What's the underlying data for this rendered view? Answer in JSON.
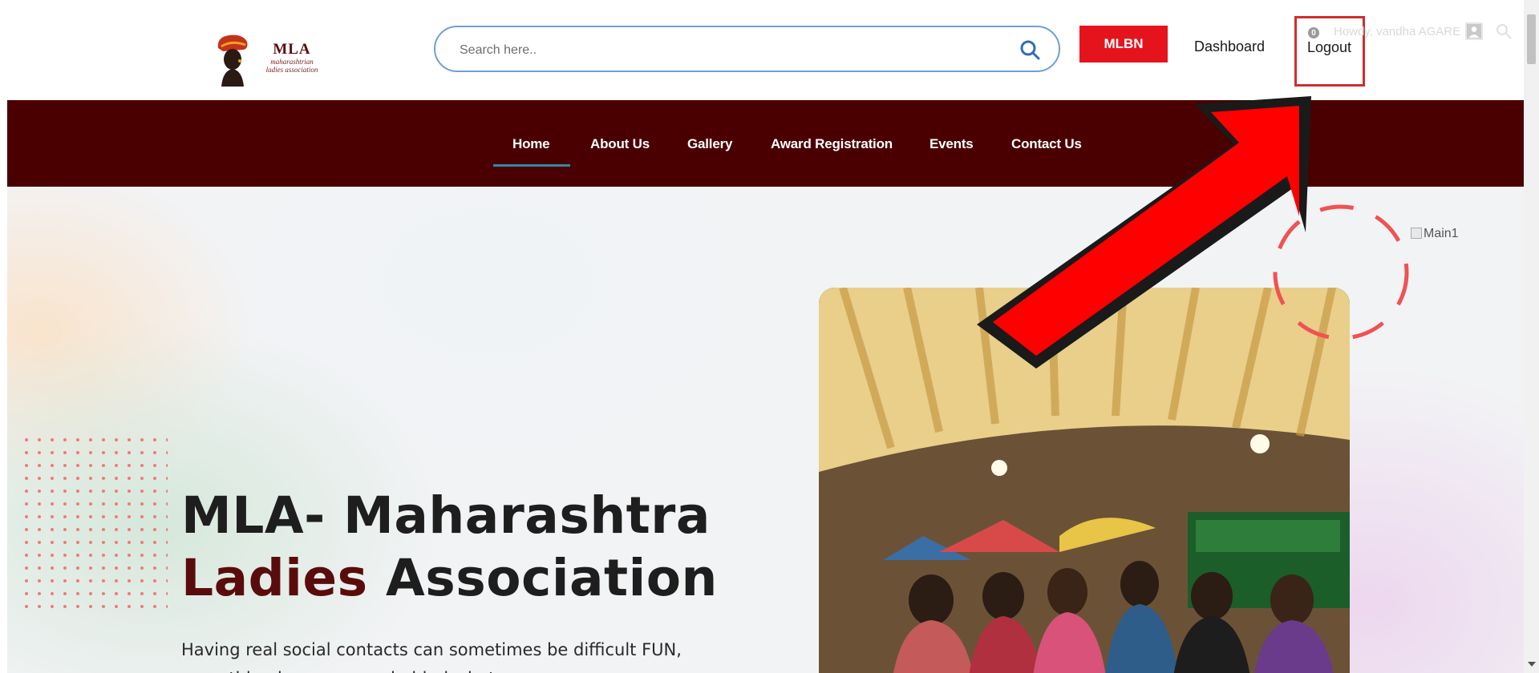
{
  "header": {
    "logo": {
      "text_main": "MLA",
      "text_sub_line1": "maharashtrian",
      "text_sub_line2": "ladies association"
    },
    "search": {
      "placeholder": "Search here.."
    },
    "mlbn_button": "MLBN",
    "dashboard_link": "Dashboard",
    "logout_link": "Logout",
    "notification_count": "0",
    "howdy_text": "Howdy, vandha AGARE"
  },
  "nav": {
    "items": [
      {
        "label": "Home",
        "active": true
      },
      {
        "label": "About Us"
      },
      {
        "label": "Gallery"
      },
      {
        "label": "Award Registration"
      },
      {
        "label": "Events"
      },
      {
        "label": "Contact Us"
      }
    ]
  },
  "hero": {
    "title_line1": "MLA- Maharashtra",
    "title_accent": "Ladies",
    "title_line2_rest": " Association",
    "text": "Having real social contacts can sometimes be difficult FUN, everything has a reason behind what",
    "broken_image_alt": "Main1"
  },
  "colors": {
    "nav_bg": "#4a0000",
    "brand_maroon": "#5a0c0c",
    "mlbn_red": "#e5141c",
    "search_border": "#6f9fd3",
    "annotation_red": "#ff0000",
    "nav_underline": "#2f8aa0"
  },
  "icons": [
    "search-icon",
    "user-avatar-icon",
    "arrow-annotation-icon"
  ]
}
